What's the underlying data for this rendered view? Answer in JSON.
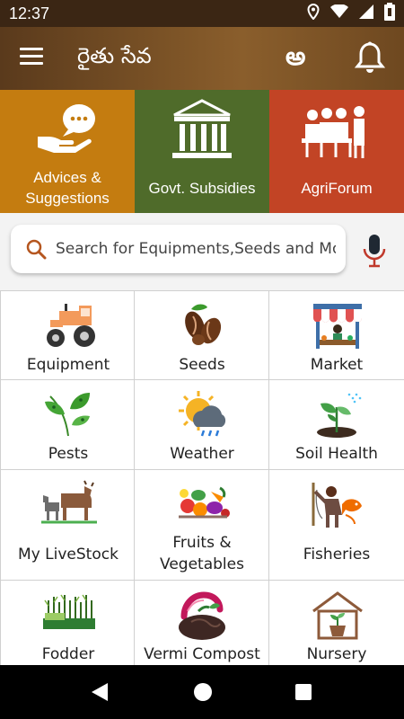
{
  "status_bar": {
    "time": "12:37"
  },
  "app_bar": {
    "title": "రైతు సేవ",
    "language_glyph": "అ",
    "menu_icon": "hamburger-icon",
    "notification_icon": "bell-icon"
  },
  "tiles": [
    {
      "label": "Advices & Suggestions",
      "color": "#c47c10",
      "icon": "hand-chat-icon"
    },
    {
      "label": "Govt. Subsidies",
      "color": "#4f6b2a",
      "icon": "government-building-icon"
    },
    {
      "label": "AgriForum",
      "color": "#c24425",
      "icon": "meeting-icon"
    }
  ],
  "search": {
    "placeholder": "Search for Equipments,Seeds and More",
    "mic_icon": "microphone-icon"
  },
  "categories": [
    {
      "label": "Equipment",
      "icon": "tractor-icon"
    },
    {
      "label": "Seeds",
      "icon": "seeds-icon"
    },
    {
      "label": "Market",
      "icon": "market-stall-icon"
    },
    {
      "label": "Pests",
      "icon": "pest-leaf-icon"
    },
    {
      "label": "Weather",
      "icon": "weather-icon"
    },
    {
      "label": "Soil Health",
      "icon": "sprout-icon"
    },
    {
      "label": "My LiveStock",
      "icon": "livestock-icon"
    },
    {
      "label": "Fruits & Vegetables",
      "icon": "fruits-vegetables-icon"
    },
    {
      "label": "Fisheries",
      "icon": "fisherman-icon"
    },
    {
      "label": "Fodder",
      "icon": "fodder-grass-icon"
    },
    {
      "label": "Vermi Compost",
      "icon": "earthworm-icon"
    },
    {
      "label": "Nursery",
      "icon": "nursery-house-icon"
    }
  ],
  "nav_bar": {
    "back_icon": "back-icon",
    "home_icon": "home-icon",
    "recents_icon": "recents-icon"
  }
}
